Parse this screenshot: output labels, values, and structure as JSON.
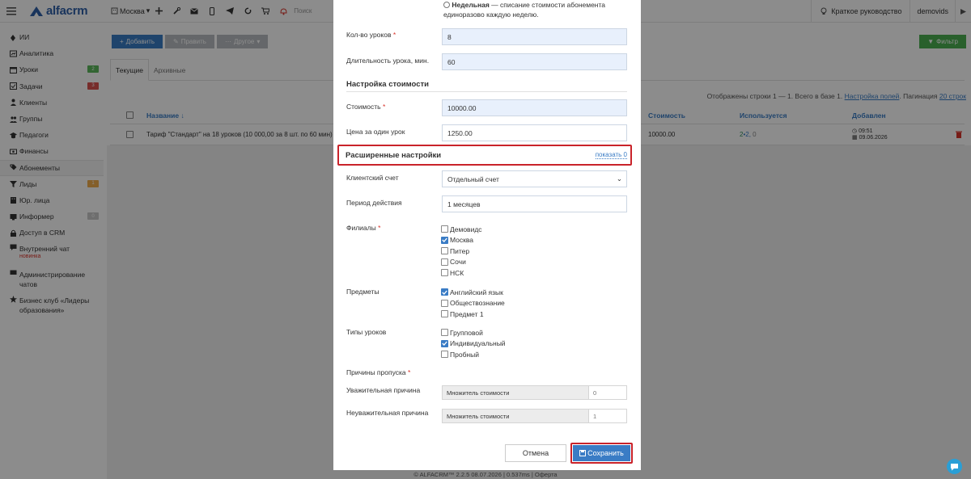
{
  "topbar": {
    "logo": "alfacrm",
    "city": "Москва",
    "search_text": "Поиск",
    "guide": "Краткое руководство",
    "user": "demovids"
  },
  "sidebar": {
    "items": [
      {
        "label": "ИИ",
        "icon": "ai-icon"
      },
      {
        "label": "Аналитика",
        "icon": "analytics-icon"
      },
      {
        "label": "Уроки",
        "icon": "calendar-icon",
        "badge": "2",
        "badge_color": "#5cb85c"
      },
      {
        "label": "Задачи",
        "icon": "tasks-icon",
        "badge": "3",
        "badge_color": "#d9534f"
      },
      {
        "label": "Клиенты",
        "icon": "user-icon"
      },
      {
        "label": "Группы",
        "icon": "group-icon"
      },
      {
        "label": "Педагоги",
        "icon": "graduation-icon"
      },
      {
        "label": "Финансы",
        "icon": "money-icon"
      },
      {
        "label": "Абонементы",
        "icon": "tag-icon",
        "active": true
      },
      {
        "label": "Лиды",
        "icon": "funnel-icon",
        "badge": "1",
        "badge_color": "#f0ad4e"
      },
      {
        "label": "Юр. лица",
        "icon": "building-icon"
      },
      {
        "label": "Информер",
        "icon": "informer-icon",
        "badge": "0",
        "badge_color": "#c8c8c8"
      },
      {
        "label": "Доступ в CRM",
        "icon": "lock-icon"
      }
    ],
    "chat": {
      "label": "Внутренний чат",
      "tag": "новинка"
    },
    "chat_admin": {
      "label": "Администрирование чатов"
    },
    "club": {
      "label": "Бизнес клуб «Лидеры образования»"
    }
  },
  "toolbar": {
    "add": "Добавить",
    "edit": "Править",
    "other": "Другое",
    "filter": "Фильтр"
  },
  "tabs": [
    "Текущие",
    "Архивные"
  ],
  "info": {
    "prefix": "Отображены строки 1 — 1. Всего в базе 1.",
    "fields": "Настройка полей",
    "pagination_label": "Пагинация",
    "pagination": "20 строк"
  },
  "table": {
    "headers": {
      "name": "Название ↓",
      "cost": "Стоимость",
      "used": "Используется",
      "added": "Добавлен"
    },
    "row": {
      "name": "Тариф \"Стандарт\" на 18 уроков (10 000,00 за 8 шт. по 60 мин)",
      "cost": "10000.00",
      "used_a": "2",
      "used_sep": " • ",
      "used_b": "2",
      "used_c": "0",
      "time": "09:51",
      "date": "09.06.2026"
    }
  },
  "footer": {
    "text": "© ALFACRM™ 2.2.5 08.07.2026 | 0.537ms | Оферта"
  },
  "modal": {
    "weekly_title": "Недельная",
    "weekly_desc": " — списание стоимости абонемента",
    "weekly_desc2": "единоразово каждую неделю.",
    "lessons_count_label": "Кол-во уроков",
    "lessons_count": "8",
    "duration_label": "Длительность урока, мин.",
    "duration": "60",
    "price_section": "Настройка стоимости",
    "cost_label": "Стоимость",
    "cost": "10000.00",
    "per_lesson_label": "Цена за один урок",
    "per_lesson": "1250.00",
    "advanced_title": "Расширенные настройки",
    "advanced_link": "показать",
    "advanced_count": "0",
    "client_account_label": "Клиентский счет",
    "client_account": "Отдельный счет",
    "period_label": "Период действия",
    "period": "1 месяцев",
    "branches_label": "Филиалы",
    "branches": [
      {
        "label": "Демовидс",
        "checked": false
      },
      {
        "label": "Москва",
        "checked": true
      },
      {
        "label": "Питер",
        "checked": false
      },
      {
        "label": "Сочи",
        "checked": false
      },
      {
        "label": "НСК",
        "checked": false
      }
    ],
    "subjects_label": "Предметы",
    "subjects": [
      {
        "label": "Английский язык",
        "checked": true
      },
      {
        "label": "Обществознание",
        "checked": false
      },
      {
        "label": "Предмет 1",
        "checked": false
      }
    ],
    "lesson_types_label": "Типы уроков",
    "lesson_types": [
      {
        "label": "Групповой",
        "checked": false
      },
      {
        "label": "Индивидуальный",
        "checked": true
      },
      {
        "label": "Пробный",
        "checked": false
      }
    ],
    "absence_label": "Причины пропуска",
    "valid_reason_label": "Уважительная причина",
    "invalid_reason_label": "Неуважительная причина",
    "multiplier_label": "Множитель стоимости",
    "valid_multiplier": "0",
    "invalid_multiplier": "1",
    "cancel": "Отмена",
    "save": "Сохранить"
  }
}
